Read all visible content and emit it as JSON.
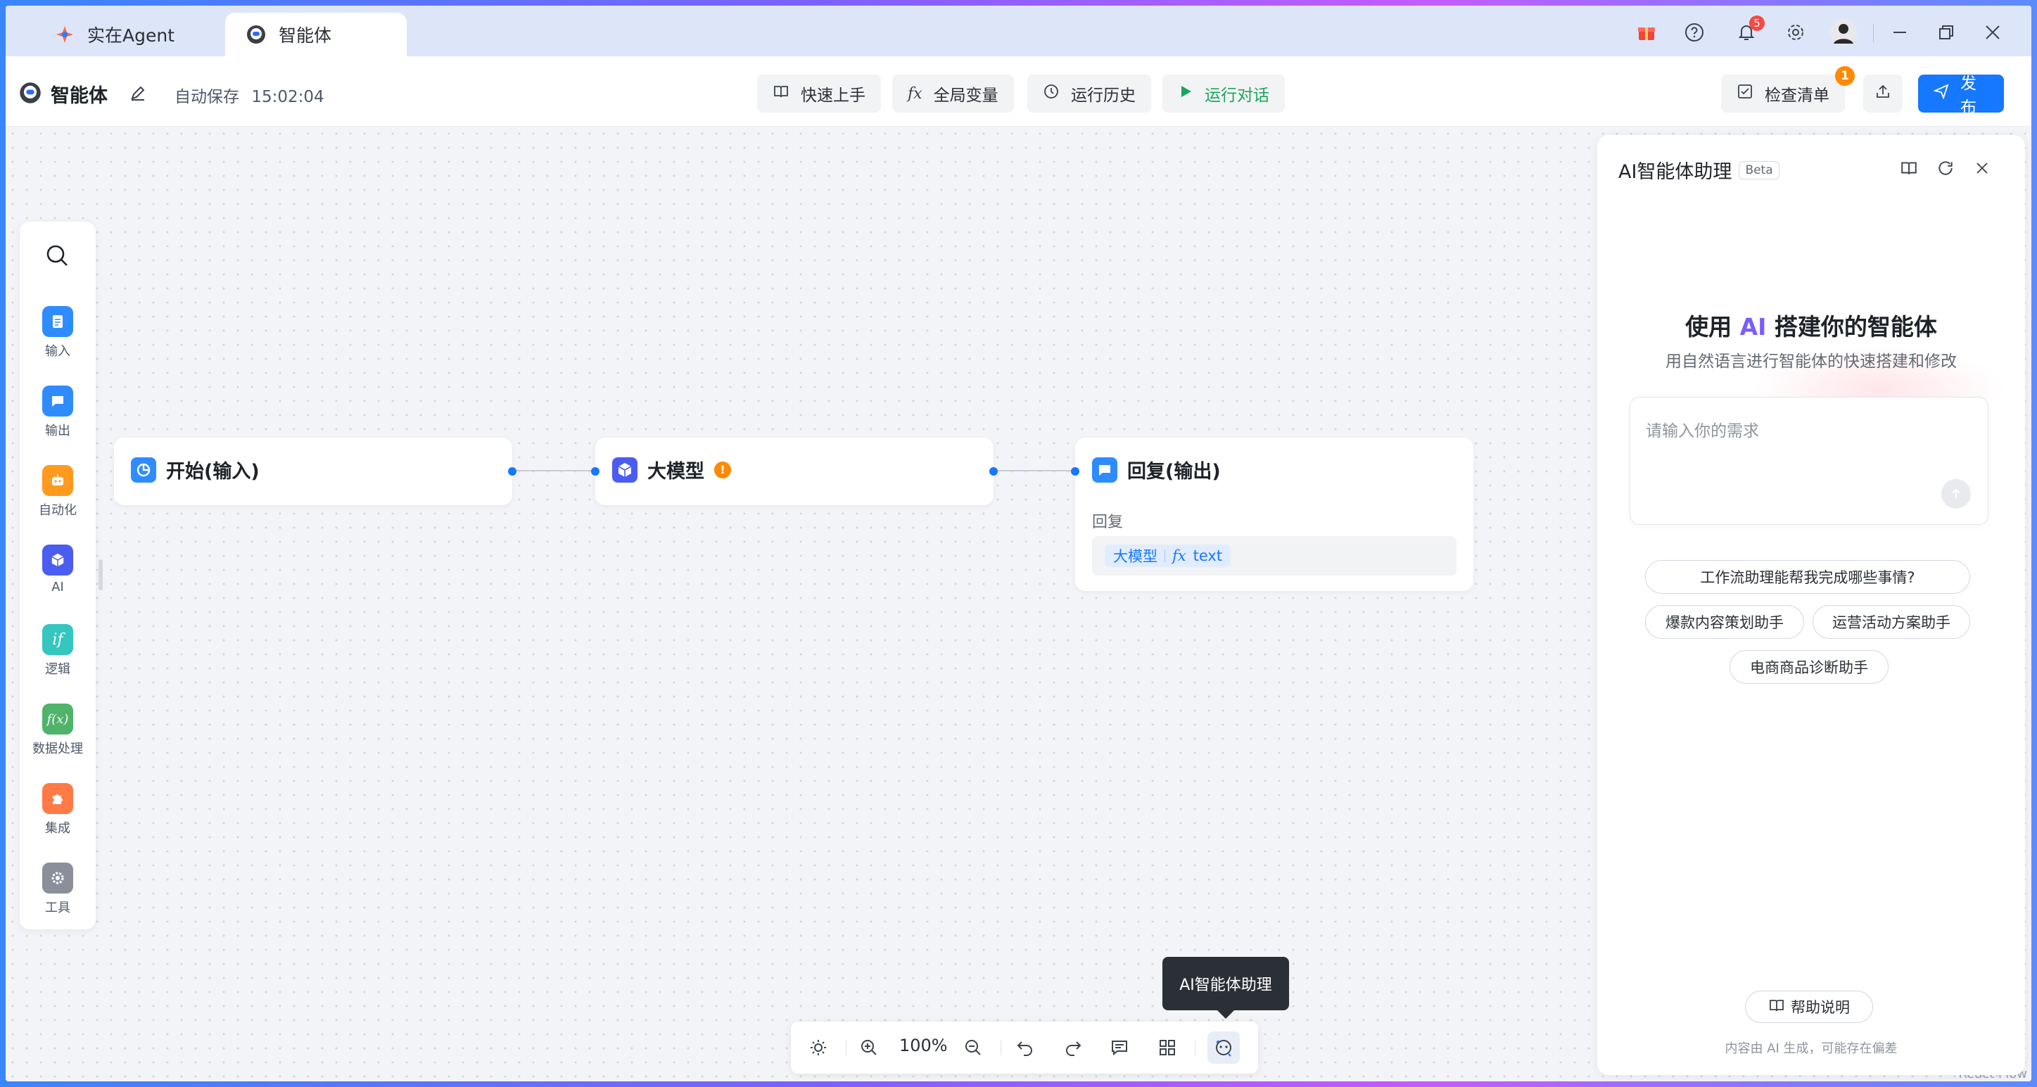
{
  "tabs": [
    {
      "label": "实在Agent"
    },
    {
      "label": "智能体"
    }
  ],
  "titlebar": {
    "notification_count": "5"
  },
  "toolbar": {
    "app_name": "智能体",
    "autosave_label": "自动保存",
    "autosave_time": "15:02:04",
    "quick_start": "快速上手",
    "global_vars": "全局变量",
    "run_history": "运行历史",
    "run_chat": "运行对话",
    "checklist": "检查清单",
    "checklist_count": "1",
    "publish": "发布"
  },
  "leftbar": {
    "items": [
      {
        "label": "输入",
        "color": "#2f8cff",
        "icon": "document-icon"
      },
      {
        "label": "输出",
        "color": "#2f8cff",
        "icon": "chat-bubble-icon"
      },
      {
        "label": "自动化",
        "color": "#ff9a1f",
        "icon": "robot-icon"
      },
      {
        "label": "AI",
        "color": "#4b5cf0",
        "icon": "cube-icon"
      },
      {
        "label": "逻辑",
        "color": "#35c6c0",
        "icon": "if-icon"
      },
      {
        "label": "数据处理",
        "color": "#4fb36a",
        "icon": "function-icon"
      },
      {
        "label": "集成",
        "color": "#ff7a45",
        "icon": "puzzle-icon"
      },
      {
        "label": "工具",
        "color": "#8a8f99",
        "icon": "gear-icon"
      }
    ]
  },
  "nodes": {
    "start": {
      "title": "开始(输入)"
    },
    "llm": {
      "title": "大模型",
      "warning": "!"
    },
    "reply": {
      "title": "回复(输出)",
      "field_label": "回复",
      "tag_source": "大模型",
      "tag_fx": "fx",
      "tag_var": "text"
    }
  },
  "controls": {
    "zoom": "100%",
    "tooltip": "AI智能体助理"
  },
  "watermark": "React Flow",
  "panel": {
    "title": "AI智能体助理",
    "beta": "Beta",
    "hero_prefix": "使用",
    "hero_ai": "AI",
    "hero_suffix": "搭建你的智能体",
    "subtitle": "用自然语言进行智能体的快速搭建和修改",
    "input_placeholder": "请输入你的需求",
    "suggestions": [
      "工作流助理能帮我完成哪些事情?",
      "爆款内容策划助手",
      "运营活动方案助手",
      "电商商品诊断助手"
    ],
    "help": "帮助说明",
    "disclaimer": "内容由 AI 生成，可能存在偏差"
  }
}
